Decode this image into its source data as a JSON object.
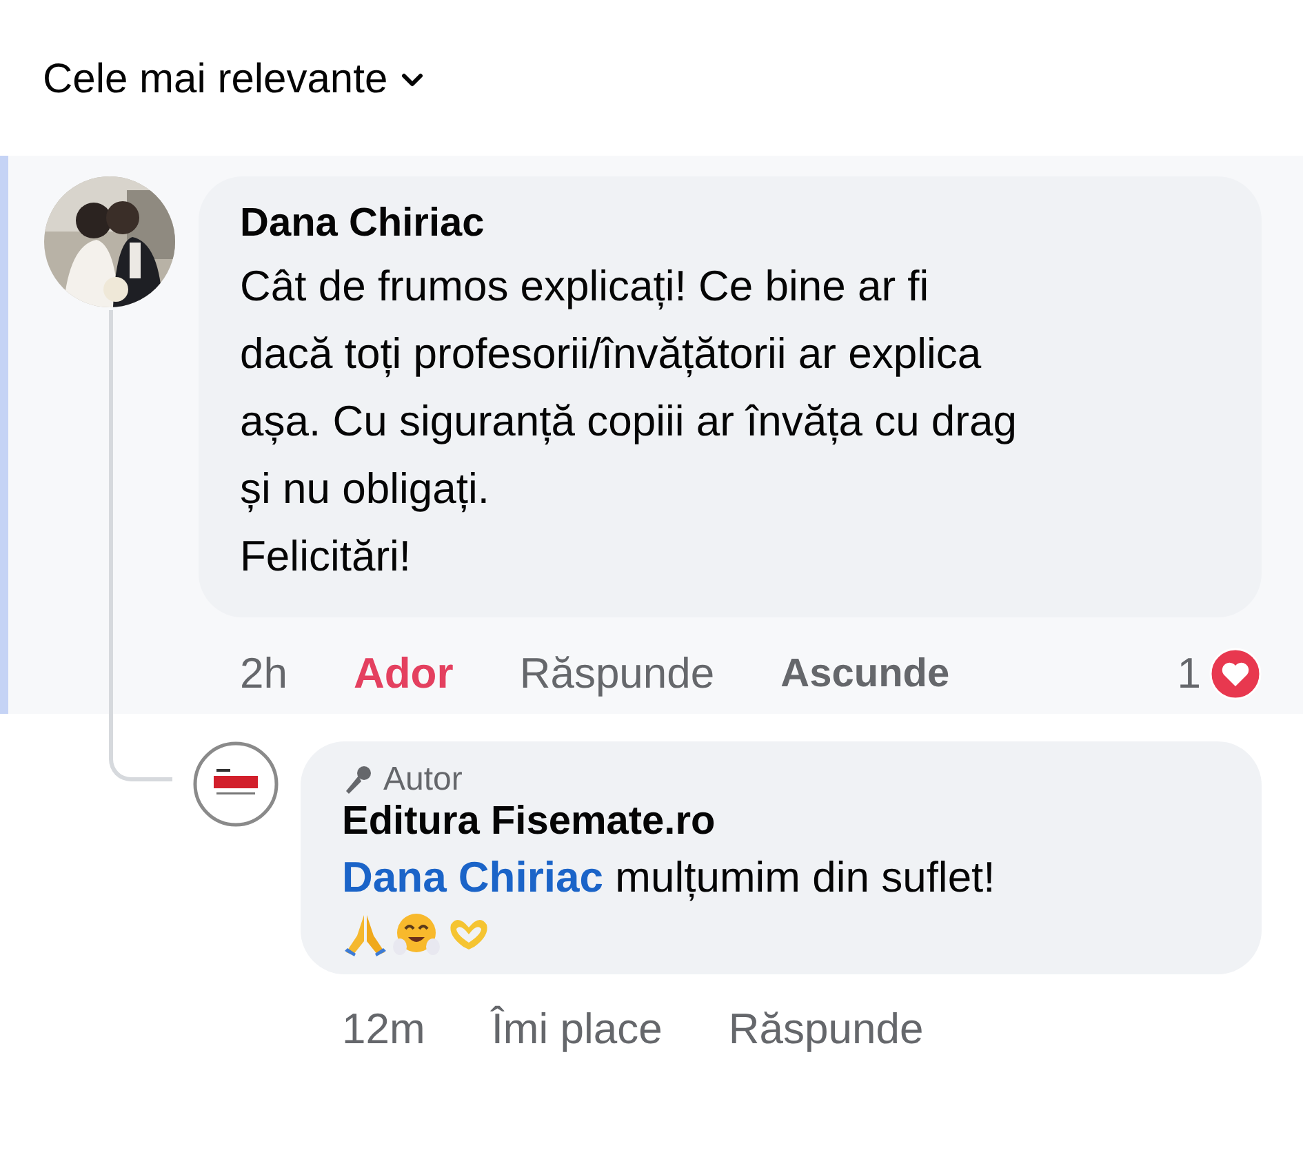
{
  "sort": {
    "label": "Cele mai relevante"
  },
  "comment": {
    "author": "Dana Chiriac",
    "highlighted": true,
    "text": "Cât de frumos explicați! Ce bine ar fi\ndacă toți profesorii/învățătorii ar explica\nașa. Cu siguranță copiii ar învăța cu drag\nși nu obligați.\nFelicitări!",
    "time": "2h",
    "like": {
      "label": "Ador",
      "selected": true
    },
    "reply_label": "Răspunde",
    "hide_label": "Ascunde",
    "reaction_count": "1"
  },
  "reply": {
    "badge": "Autor",
    "author": "Editura Fisemate.ro",
    "mention": "Dana Chiriac",
    "text": "mulțumim din suflet!",
    "time": "12m",
    "like": {
      "label": "Îmi place",
      "selected": false
    },
    "reply_label": "Răspunde"
  }
}
